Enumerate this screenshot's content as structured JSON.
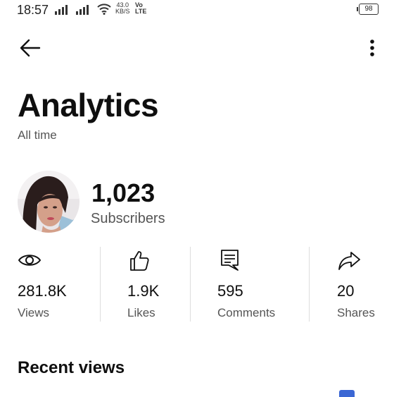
{
  "status_bar": {
    "time": "18:57",
    "network_speed_value": "43.0",
    "network_speed_unit": "KB/S",
    "volte_top": "Vo",
    "volte_bottom": "LTE",
    "battery": "98"
  },
  "icons": {
    "back": "arrow-left-icon",
    "more": "more-vertical-icon",
    "views": "eye-icon",
    "likes": "thumbs-up-icon",
    "comments": "comment-icon",
    "shares": "share-icon"
  },
  "page": {
    "title": "Analytics",
    "subtitle": "All time"
  },
  "channel": {
    "subscriber_count": "1,023",
    "subscriber_label": "Subscribers"
  },
  "stats": [
    {
      "value": "281.8K",
      "label": "Views"
    },
    {
      "value": "1.9K",
      "label": "Likes"
    },
    {
      "value": "595",
      "label": "Comments"
    },
    {
      "value": "20",
      "label": "Shares"
    }
  ],
  "recent": {
    "title": "Recent views"
  },
  "colors": {
    "text_primary": "#0f0f0f",
    "text_secondary": "#555555",
    "divider": "#dddddd",
    "accent_peek": "#3b67d4"
  }
}
